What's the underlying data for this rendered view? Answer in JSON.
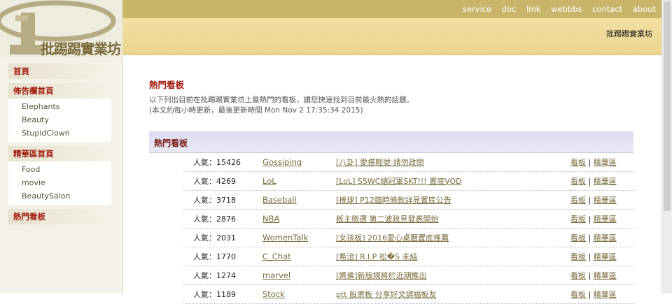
{
  "logo": {
    "text": "批踢踢實業坊"
  },
  "top_nav": [
    "service",
    "doc",
    "link",
    "webbbs",
    "contact",
    "about"
  ],
  "site_name": "批踢踢實業坊",
  "sidebar": {
    "home": "首頁",
    "board_index": "佈告欄首頁",
    "board_items": [
      "Elephants",
      "Beauty",
      "StupidClown"
    ],
    "digest_index": "精華區首頁",
    "digest_items": [
      "Food",
      "movie",
      "BeautySalon"
    ],
    "hot_boards": "熱門看板"
  },
  "main": {
    "title": "熱門看板",
    "description": "以下列出目前在批踢踢實業坊上最熱門的看板，讓您快速找到目前最火熱的話題。",
    "update_note": "(本文約每小時更新，最後更新時間 Mon Nov 2 17:35:34 2015)",
    "section_title": "熱門看板"
  },
  "boards": [
    {
      "popularity": "人氣：15426",
      "name": "Gossiping",
      "article": "[八卦] 愛搭輕號 請勿政問",
      "view": "看板",
      "digest": "精華區"
    },
    {
      "popularity": "人氣：4269",
      "name": "LoL",
      "article": "[LoL] S5WC總冠軍SKT!!! 置底VOD",
      "view": "看板",
      "digest": "精華區"
    },
    {
      "popularity": "人氣：3718",
      "name": "Baseball",
      "article": "[棒球] P12臨時條款詳見置底公告",
      "view": "看板",
      "digest": "精華區"
    },
    {
      "popularity": "人氣：2876",
      "name": "NBA",
      "article": "板主徵選 第二波政見發表開始",
      "view": "看板",
      "digest": "精華區"
    },
    {
      "popularity": "人氣：2031",
      "name": "WomenTalk",
      "article": "[女孩板] 2016愛心桌曆置底推薦",
      "view": "看板",
      "digest": "精華區"
    },
    {
      "popularity": "人氣：1770",
      "name": "C_Chat",
      "article": "[希洽] R.I.P 松�S 未結",
      "view": "看板",
      "digest": "精華區"
    },
    {
      "popularity": "人氣：1274",
      "name": "marvel",
      "article": "[媽佛]新版規將於近期推出",
      "view": "看板",
      "digest": "精華區"
    },
    {
      "popularity": "人氣：1189",
      "name": "Stock",
      "article": "ptt 股票板 分享好文請福板友",
      "view": "看板",
      "digest": "精華區"
    }
  ],
  "colors": {
    "topbar": "#c9b56a",
    "subbar": "#f0dc9c",
    "accent_red": "#a21d12",
    "link_olive": "#7a6a3a",
    "section_bar": "#e2e2f2"
  },
  "icons": [
    "ptt-logo"
  ]
}
